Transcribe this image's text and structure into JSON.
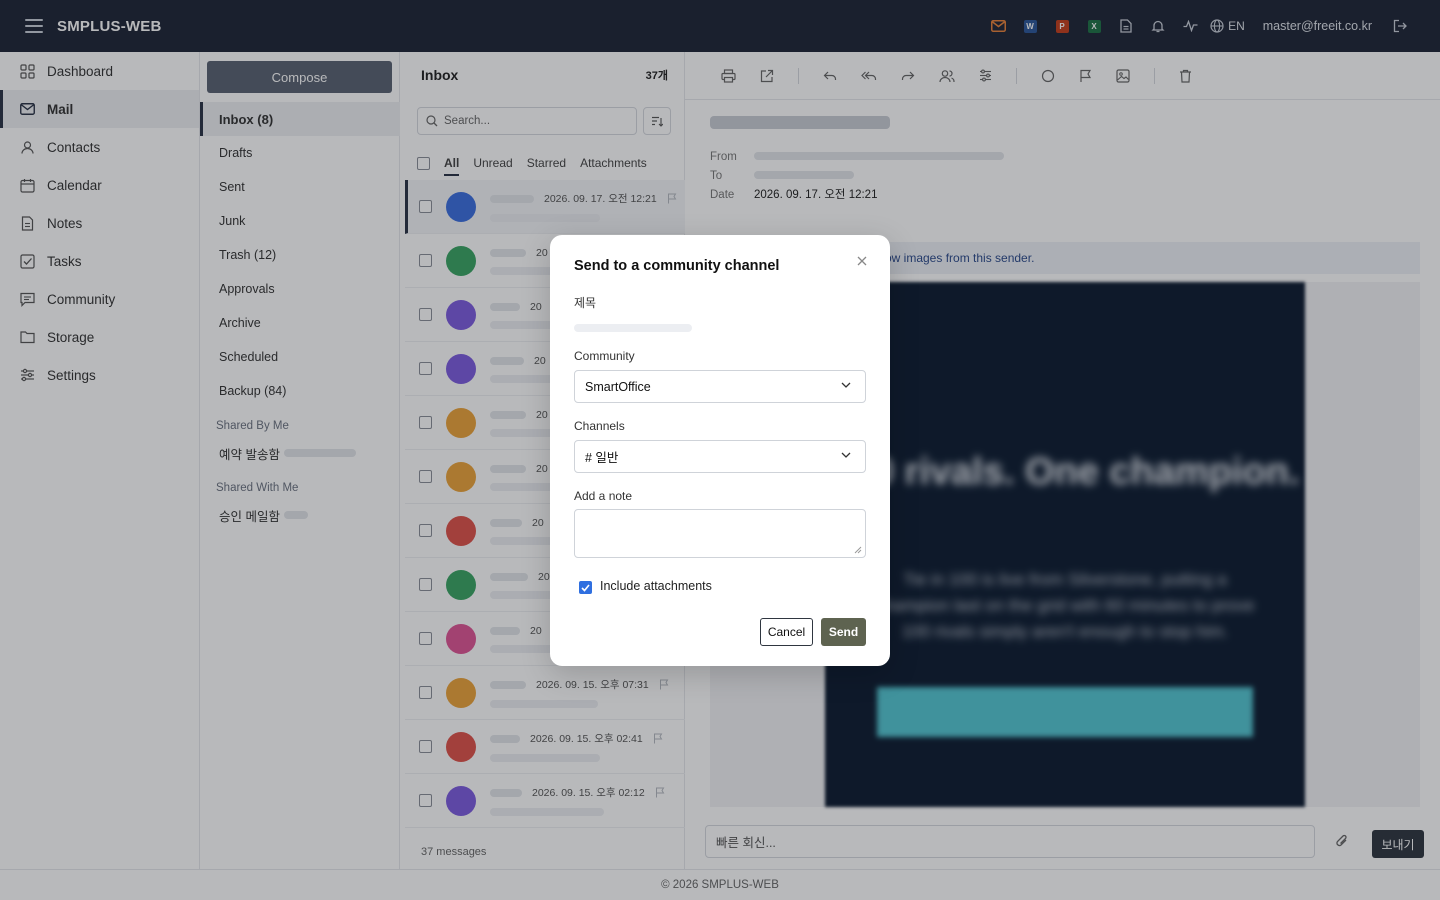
{
  "app": {
    "title": "SMPLUS-WEB"
  },
  "topbar": {
    "lang": "EN",
    "user_email": "master@freeit.co.kr",
    "icons": [
      "mail-icon",
      "word-icon",
      "powerpoint-icon",
      "excel-icon",
      "document-icon",
      "bell-icon",
      "activity-icon",
      "globe-icon",
      "logout-icon"
    ],
    "app_badges": {
      "word": "W",
      "powerpoint": "P",
      "excel": "X"
    },
    "colors": {
      "mail": "#e8823a",
      "word": "#2b579a",
      "powerpoint": "#c43e1c",
      "excel": "#1e7145",
      "bar": "#1e2535"
    }
  },
  "nav": {
    "items": [
      {
        "label": "Dashboard",
        "icon": "grid-icon"
      },
      {
        "label": "Mail",
        "icon": "mail-icon"
      },
      {
        "label": "Contacts",
        "icon": "user-icon"
      },
      {
        "label": "Calendar",
        "icon": "calendar-icon"
      },
      {
        "label": "Notes",
        "icon": "notes-icon"
      },
      {
        "label": "Tasks",
        "icon": "checkbox-icon"
      },
      {
        "label": "Community",
        "icon": "chat-icon"
      },
      {
        "label": "Storage",
        "icon": "folder-icon"
      },
      {
        "label": "Settings",
        "icon": "sliders-icon"
      }
    ]
  },
  "folders": {
    "compose_label": "Compose",
    "items": [
      "Inbox (8)",
      "Drafts",
      "Sent",
      "Junk",
      "Trash (12)",
      "Approvals",
      "Archive",
      "Scheduled",
      "Backup (84)"
    ],
    "shared_by_me": "Shared By Me",
    "shared_by_me_item": "예약 발송함",
    "shared_with_me": "Shared With Me",
    "shared_with_me_item": "승인 메일함"
  },
  "list": {
    "title": "Inbox",
    "count": "37개",
    "search_placeholder": "Search...",
    "tabs": [
      "All",
      "Unread",
      "Starred",
      "Attachments"
    ],
    "rows": [
      {
        "date": "2026. 09. 17. 오전 12:21",
        "color": "#3b6fe0"
      },
      {
        "date": "20",
        "color": "#3aa564"
      },
      {
        "date": "20",
        "color": "#7d5ce0"
      },
      {
        "date": "20",
        "color": "#7d5ce0"
      },
      {
        "date": "20",
        "color": "#eda43a"
      },
      {
        "date": "20",
        "color": "#eda43a"
      },
      {
        "date": "20",
        "color": "#e0524a"
      },
      {
        "date": "20",
        "color": "#3aa564"
      },
      {
        "date": "20",
        "color": "#e05596"
      },
      {
        "date": "2026. 09. 15. 오후 07:31",
        "color": "#eda43a"
      },
      {
        "date": "2026. 09. 15. 오후 02:41",
        "color": "#e0524a"
      },
      {
        "date": "2026. 09. 15. 오후 02:12",
        "color": "#7d5ce0"
      }
    ],
    "footer": "37 messages"
  },
  "reader": {
    "from_label": "From",
    "to_label": "To",
    "date_label": "Date",
    "date_value": "2026. 09. 17. 오전 12:21",
    "images_note": "ow images from this sender.",
    "quick_reply_placeholder": "빠른 회신...",
    "quick_reply_send": "보내기"
  },
  "modal": {
    "title": "Send to a community channel",
    "subject_label": "제목",
    "community_label": "Community",
    "community_value": "SmartOffice",
    "channels_label": "Channels",
    "channels_value": "# 일반",
    "note_label": "Add a note",
    "include_attachments_label": "Include attachments",
    "include_attachments_checked": true,
    "cancel_label": "Cancel",
    "send_label": "Send"
  },
  "footer": {
    "text": "© 2026 SMPLUS-WEB"
  }
}
